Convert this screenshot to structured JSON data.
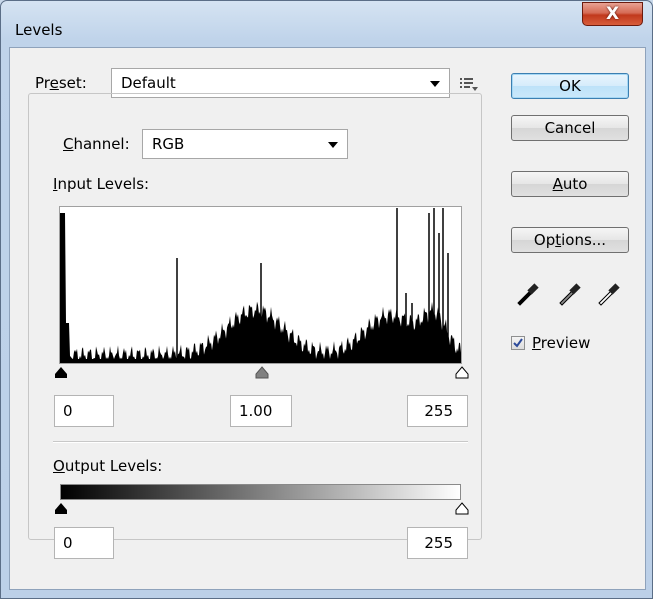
{
  "window": {
    "title": "Levels",
    "close_glyph": "X"
  },
  "preset": {
    "label_before": "Pr",
    "label_accel": "e",
    "label_after": "set:",
    "value": "Default",
    "menu_icon": "preset-options-icon"
  },
  "channel": {
    "label_accel": "C",
    "label_after": "hannel:",
    "value": "RGB"
  },
  "input_levels": {
    "label_accel": "I",
    "label_after": "nput Levels:",
    "shadow_value": "0",
    "midtone_value": "1.00",
    "highlight_value": "255",
    "shadow_slider": 0,
    "midtone_slider": 1.0,
    "highlight_slider": 255
  },
  "output_levels": {
    "label_accel": "O",
    "label_after": "utput Levels:",
    "shadow_value": "0",
    "highlight_value": "255",
    "shadow_slider": 0,
    "highlight_slider": 255
  },
  "buttons": {
    "ok": "OK",
    "cancel": "Cancel",
    "auto_accel": "A",
    "auto_after": "uto",
    "options_before": "Op",
    "options_accel": "t",
    "options_after": "ions..."
  },
  "eyedroppers": [
    "black-point-eyedropper-icon",
    "gray-point-eyedropper-icon",
    "white-point-eyedropper-icon"
  ],
  "preview": {
    "accel": "P",
    "after": "review",
    "checked": true
  },
  "colors": {
    "accent": "#3c7fb1",
    "close": "#c1391d",
    "frame": "#bcd0e8"
  }
}
